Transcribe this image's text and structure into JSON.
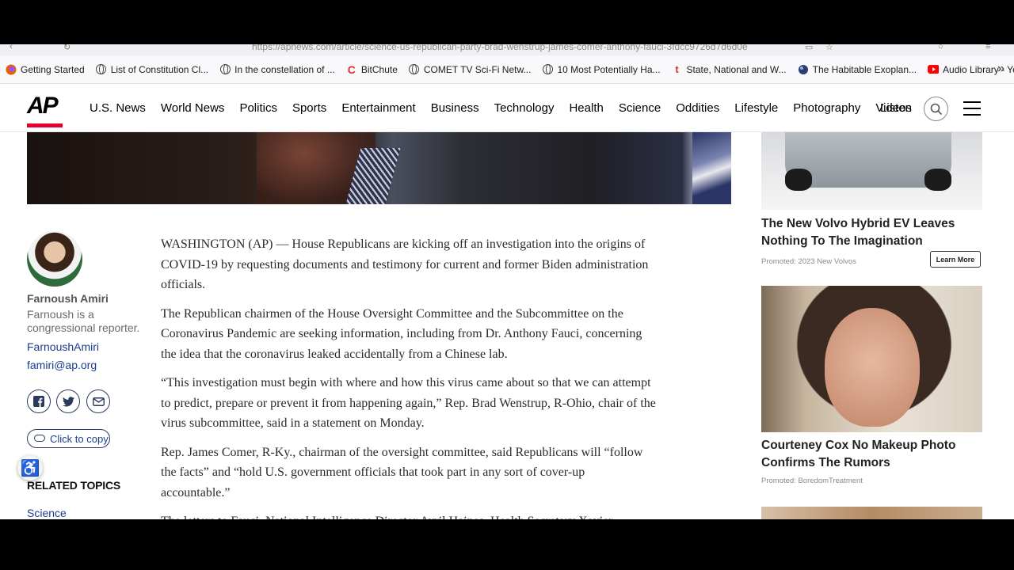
{
  "browser": {
    "url": "https://apnews.com/article/science-us-republican-party-brad-wenstrup-james-comer-anthony-fauci-3fdcc9726d7d6d0e",
    "bookmarks": [
      {
        "label": "Getting Started",
        "icon": "firefox-icon"
      },
      {
        "label": "List of Constitution Cl...",
        "icon": "globe-icon"
      },
      {
        "label": "In the constellation of ...",
        "icon": "globe-icon"
      },
      {
        "label": "BitChute",
        "icon": "bitchute-icon"
      },
      {
        "label": "COMET TV Sci-Fi Netw...",
        "icon": "globe-icon"
      },
      {
        "label": "10 Most Potentially Ha...",
        "icon": "globe-icon"
      },
      {
        "label": "State, National and W...",
        "icon": "t-icon"
      },
      {
        "label": "The Habitable Exoplan...",
        "icon": "planet-icon"
      },
      {
        "label": "Audio Library - YouTube",
        "icon": "youtube-icon"
      }
    ]
  },
  "nav": {
    "logo": "AP",
    "links": [
      "U.S. News",
      "World News",
      "Politics",
      "Sports",
      "Entertainment",
      "Business",
      "Technology",
      "Health",
      "Science",
      "Oddities",
      "Lifestyle",
      "Photography",
      "Videos"
    ],
    "listen": "Listen"
  },
  "author": {
    "name": "Farnoush Amiri",
    "bio": "Farnoush is a congressional reporter.",
    "handle": "FarnoushAmiri",
    "email": "famiri@ap.org",
    "copy_label": "Click to copy",
    "related_label": "RELATED TOPICS",
    "topic": "Science"
  },
  "article": {
    "paragraphs": [
      "WASHINGTON (AP) — House Republicans are kicking off an investigation into the origins of COVID-19 by requesting documents and testimony for current and former Biden administration officials.",
      "The Republican chairmen of the House Oversight Committee and the Subcommittee on the Coronavirus Pandemic are seeking information, including from Dr. Anthony Fauci, concerning the idea that the coronavirus leaked accidentally from a Chinese lab.",
      "“This investigation must begin with where and how this virus came about so that we can attempt to predict, prepare or prevent it from happening again,” Rep. Brad Wenstrup, R-Ohio, chair of the virus subcommittee, said in a statement on Monday.",
      "Rep. James Comer, R-Ky., chairman of the oversight committee, said Republicans will “follow the facts” and “hold U.S. government officials that took part in any sort of cover-up accountable.”",
      "The letters to Fauci, National Intelligence Director Avril Haines, Health Secretary Xavier"
    ]
  },
  "ads": [
    {
      "title": "The New Volvo Hybrid EV Leaves Nothing To The Imagination",
      "promo": "Promoted: 2023 New Volvos",
      "button": "Learn More"
    },
    {
      "title": "Courteney Cox No Makeup Photo Confirms The Rumors",
      "promo": "Promoted: BoredomTreatment"
    }
  ]
}
